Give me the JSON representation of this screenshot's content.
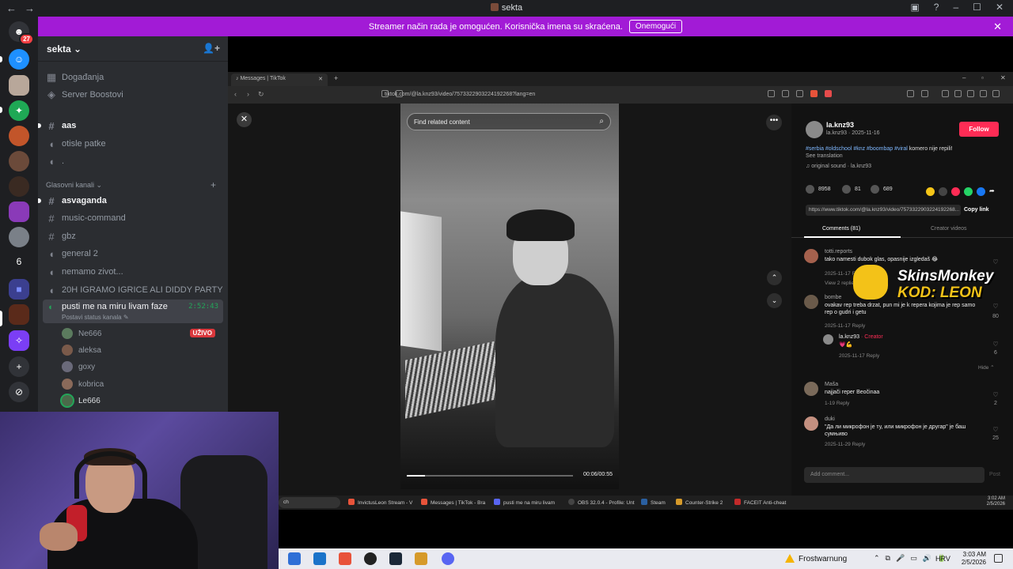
{
  "window": {
    "title": "sekta",
    "back": "←",
    "forward": "→",
    "controls": [
      "▣",
      "?",
      "–",
      "☐",
      "✕"
    ]
  },
  "rail": {
    "badge_count": "27",
    "folder_count": "6",
    "add": "+",
    "discover": "⊘"
  },
  "banner": {
    "text": "Streamer način rada je omogućen. Korisnička imena su skraćena.",
    "button": "Onemogući",
    "close": "✕"
  },
  "server": {
    "name": "sekta ⌄",
    "add_icon": "+"
  },
  "channels": {
    "events": "Događanja",
    "boosts": "Server Boostovi",
    "text": [
      {
        "name": "aas",
        "icon": "#"
      },
      {
        "name": "otisle patke",
        "icon": "◖"
      },
      {
        "name": ".",
        "icon": "◖"
      }
    ],
    "voice_category": "Glasovni kanali ⌄",
    "voice_category_add": "+",
    "voice": [
      {
        "name": "asvaganda",
        "icon": "#"
      },
      {
        "name": "music-command",
        "icon": "#"
      },
      {
        "name": "gbz",
        "icon": "#"
      },
      {
        "name": "general 2",
        "icon": "◖"
      },
      {
        "name": "nemamo zivot...",
        "icon": "◖"
      },
      {
        "name": "20H IGRAMO IGRICE ALI DIDDY PARTY",
        "icon": "◖"
      }
    ],
    "active": {
      "name": "pusti me na miru livam faze",
      "timer": "2:52:43",
      "status": "Postavi status kanala ✎",
      "icon": "◖"
    },
    "users": [
      {
        "name": "Ne666",
        "live": "UŽIVO"
      },
      {
        "name": "aleksa"
      },
      {
        "name": "goxy"
      },
      {
        "name": "kobrica"
      },
      {
        "name": "Le666"
      }
    ]
  },
  "browser": {
    "tab": "Messages | TikTok",
    "tab_close": "✕",
    "new_tab": "+",
    "url": "tiktok.com/@la.knz93/video/7573322903224192268?lang=en",
    "back": "‹",
    "forward": "›",
    "reload": "↻",
    "window_controls": [
      "–",
      "▫",
      "✕"
    ]
  },
  "tiktok": {
    "close": "✕",
    "search_placeholder": "Find related content",
    "search_icon": "⌕",
    "more": "•••",
    "up": "⌃",
    "down": "⌄",
    "video_time": "00:06/00:55",
    "progress": 0.11,
    "author": "la.knz93",
    "author_meta": "la.knz93 · 2025-11-16",
    "follow": "Follow",
    "hashtags": "#serbia #oldschool #knz #boombap #viral",
    "caption": "komero nije repili!",
    "see_translation": "See translation",
    "sound": "♫ original sound · la.knz93",
    "likes": "8958",
    "comments_count": "81",
    "saves": "689",
    "link": "https://www.tiktok.com/@la.knz93/video/7573322903224192268...",
    "copy_link": "Copy link",
    "tab_comments": "Comments (81)",
    "tab_creator": "Creator videos",
    "comments": [
      {
        "user": "totti.reports",
        "text": "tako namesti dubok glas, opasnije izgledaš 😂",
        "meta": "2025-11-17   Reply",
        "likes": "",
        "view": "View 2 replies ⌄"
      },
      {
        "user": "bombe",
        "text": "ovakav rep treba drzat, pun mi je k repera kojima je rep samo rep o gudri i getu",
        "meta": "2025-11-17   Reply",
        "likes": "80"
      },
      {
        "user": "la.knz93",
        "creator": "· Creator",
        "text": "💗💪",
        "meta": "2025-11-17   Reply",
        "likes": "6",
        "hide": "Hide ⌃"
      },
      {
        "user": "Maša",
        "text": "najjači reper Beočinaa",
        "meta": "1-19   Reply",
        "likes": "2"
      },
      {
        "user": "duki",
        "text": "\"Да ли микрофон је ту, или микрофон је другар\" је баш сумњиво",
        "meta": "2025-11-29   Reply",
        "likes": "25"
      }
    ],
    "add_comment": "Add comment...",
    "post": "Post",
    "mute_icon": "🔊",
    "pip_icon": "⧉"
  },
  "overlay": {
    "brand": "SkinsMonkey",
    "code": "KOD: LEON"
  },
  "stream_taskbar": {
    "search": "ch",
    "items": [
      "InvictusLeon Stream - V",
      "Messages | TikTok - Bra",
      "pusti me na miru livam",
      "OBS 32.0.4 - Profile: Unt",
      "Steam",
      "Counter-Strike 2",
      "FACEIT Anti-cheat"
    ],
    "clock_time": "3:02 AM",
    "clock_date": "2/5/2026"
  },
  "taskbar": {
    "weather": "Frostwarnung",
    "language": "HRV",
    "time": "3:03 AM",
    "date": "2/5/2026",
    "tray": [
      "⌃",
      "⧉",
      "🎤",
      "▭",
      "🔊",
      "🔋"
    ]
  },
  "colors": {
    "banner": "#a21bd6",
    "live": "#da373c",
    "tiktok_red": "#fe2c55",
    "overlay_yellow": "#f3c218"
  }
}
